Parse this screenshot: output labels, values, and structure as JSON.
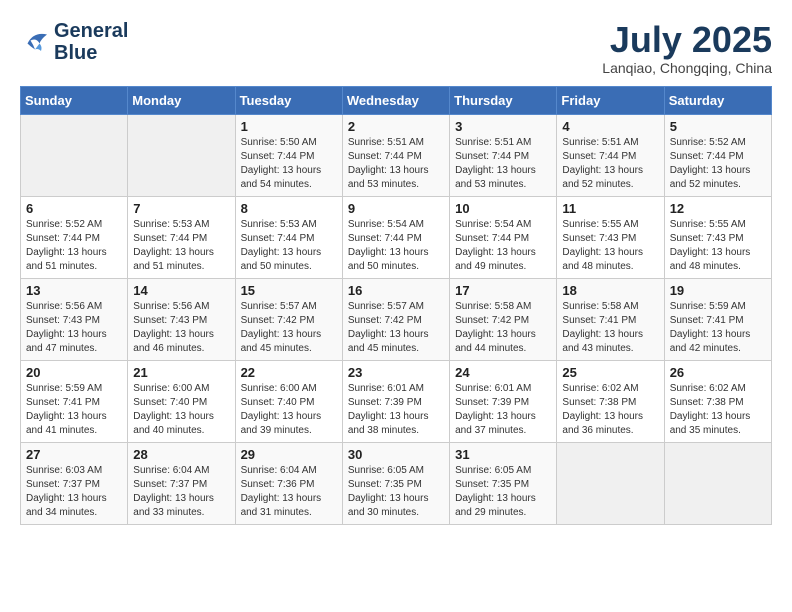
{
  "header": {
    "logo_line1": "General",
    "logo_line2": "Blue",
    "month": "July 2025",
    "location": "Lanqiao, Chongqing, China"
  },
  "weekdays": [
    "Sunday",
    "Monday",
    "Tuesday",
    "Wednesday",
    "Thursday",
    "Friday",
    "Saturday"
  ],
  "weeks": [
    [
      {
        "day": "",
        "info": ""
      },
      {
        "day": "",
        "info": ""
      },
      {
        "day": "1",
        "info": "Sunrise: 5:50 AM\nSunset: 7:44 PM\nDaylight: 13 hours and 54 minutes."
      },
      {
        "day": "2",
        "info": "Sunrise: 5:51 AM\nSunset: 7:44 PM\nDaylight: 13 hours and 53 minutes."
      },
      {
        "day": "3",
        "info": "Sunrise: 5:51 AM\nSunset: 7:44 PM\nDaylight: 13 hours and 53 minutes."
      },
      {
        "day": "4",
        "info": "Sunrise: 5:51 AM\nSunset: 7:44 PM\nDaylight: 13 hours and 52 minutes."
      },
      {
        "day": "5",
        "info": "Sunrise: 5:52 AM\nSunset: 7:44 PM\nDaylight: 13 hours and 52 minutes."
      }
    ],
    [
      {
        "day": "6",
        "info": "Sunrise: 5:52 AM\nSunset: 7:44 PM\nDaylight: 13 hours and 51 minutes."
      },
      {
        "day": "7",
        "info": "Sunrise: 5:53 AM\nSunset: 7:44 PM\nDaylight: 13 hours and 51 minutes."
      },
      {
        "day": "8",
        "info": "Sunrise: 5:53 AM\nSunset: 7:44 PM\nDaylight: 13 hours and 50 minutes."
      },
      {
        "day": "9",
        "info": "Sunrise: 5:54 AM\nSunset: 7:44 PM\nDaylight: 13 hours and 50 minutes."
      },
      {
        "day": "10",
        "info": "Sunrise: 5:54 AM\nSunset: 7:44 PM\nDaylight: 13 hours and 49 minutes."
      },
      {
        "day": "11",
        "info": "Sunrise: 5:55 AM\nSunset: 7:43 PM\nDaylight: 13 hours and 48 minutes."
      },
      {
        "day": "12",
        "info": "Sunrise: 5:55 AM\nSunset: 7:43 PM\nDaylight: 13 hours and 48 minutes."
      }
    ],
    [
      {
        "day": "13",
        "info": "Sunrise: 5:56 AM\nSunset: 7:43 PM\nDaylight: 13 hours and 47 minutes."
      },
      {
        "day": "14",
        "info": "Sunrise: 5:56 AM\nSunset: 7:43 PM\nDaylight: 13 hours and 46 minutes."
      },
      {
        "day": "15",
        "info": "Sunrise: 5:57 AM\nSunset: 7:42 PM\nDaylight: 13 hours and 45 minutes."
      },
      {
        "day": "16",
        "info": "Sunrise: 5:57 AM\nSunset: 7:42 PM\nDaylight: 13 hours and 45 minutes."
      },
      {
        "day": "17",
        "info": "Sunrise: 5:58 AM\nSunset: 7:42 PM\nDaylight: 13 hours and 44 minutes."
      },
      {
        "day": "18",
        "info": "Sunrise: 5:58 AM\nSunset: 7:41 PM\nDaylight: 13 hours and 43 minutes."
      },
      {
        "day": "19",
        "info": "Sunrise: 5:59 AM\nSunset: 7:41 PM\nDaylight: 13 hours and 42 minutes."
      }
    ],
    [
      {
        "day": "20",
        "info": "Sunrise: 5:59 AM\nSunset: 7:41 PM\nDaylight: 13 hours and 41 minutes."
      },
      {
        "day": "21",
        "info": "Sunrise: 6:00 AM\nSunset: 7:40 PM\nDaylight: 13 hours and 40 minutes."
      },
      {
        "day": "22",
        "info": "Sunrise: 6:00 AM\nSunset: 7:40 PM\nDaylight: 13 hours and 39 minutes."
      },
      {
        "day": "23",
        "info": "Sunrise: 6:01 AM\nSunset: 7:39 PM\nDaylight: 13 hours and 38 minutes."
      },
      {
        "day": "24",
        "info": "Sunrise: 6:01 AM\nSunset: 7:39 PM\nDaylight: 13 hours and 37 minutes."
      },
      {
        "day": "25",
        "info": "Sunrise: 6:02 AM\nSunset: 7:38 PM\nDaylight: 13 hours and 36 minutes."
      },
      {
        "day": "26",
        "info": "Sunrise: 6:02 AM\nSunset: 7:38 PM\nDaylight: 13 hours and 35 minutes."
      }
    ],
    [
      {
        "day": "27",
        "info": "Sunrise: 6:03 AM\nSunset: 7:37 PM\nDaylight: 13 hours and 34 minutes."
      },
      {
        "day": "28",
        "info": "Sunrise: 6:04 AM\nSunset: 7:37 PM\nDaylight: 13 hours and 33 minutes."
      },
      {
        "day": "29",
        "info": "Sunrise: 6:04 AM\nSunset: 7:36 PM\nDaylight: 13 hours and 31 minutes."
      },
      {
        "day": "30",
        "info": "Sunrise: 6:05 AM\nSunset: 7:35 PM\nDaylight: 13 hours and 30 minutes."
      },
      {
        "day": "31",
        "info": "Sunrise: 6:05 AM\nSunset: 7:35 PM\nDaylight: 13 hours and 29 minutes."
      },
      {
        "day": "",
        "info": ""
      },
      {
        "day": "",
        "info": ""
      }
    ]
  ]
}
